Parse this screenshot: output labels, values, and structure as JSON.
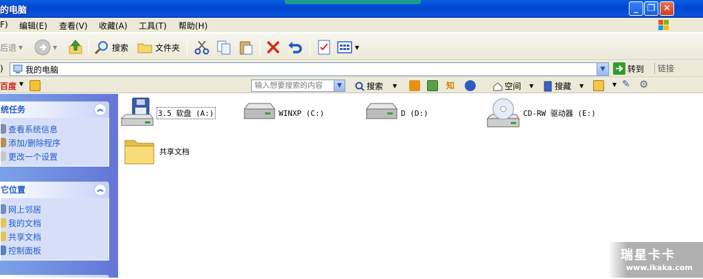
{
  "window": {
    "title": "的电脑",
    "minimize": "_",
    "restore": "❐",
    "close": "✕"
  },
  "menu": [
    "F)",
    "编辑(E)",
    "查看(V)",
    "收藏(A)",
    "工具(T)",
    "帮助(H)"
  ],
  "toolbar": {
    "back": "后退",
    "search": "搜索",
    "folders": "文件夹"
  },
  "address": {
    "value": "我的电脑",
    "go": "转到",
    "links": "链接"
  },
  "baidu": {
    "logo": "百度",
    "search_placeholder": "输入想要搜索的内容",
    "search_btn": "搜索",
    "space": "空间",
    "collect": "搜藏"
  },
  "left_panels": {
    "system_tasks": {
      "title": "统任务",
      "items": [
        "查看系统信息",
        "添加/删除程序",
        "更改一个设置"
      ]
    },
    "other_places": {
      "title": "它位置",
      "items": [
        "网上邻居",
        "我的文档",
        "共享文档",
        "控制面板"
      ]
    }
  },
  "drives": [
    {
      "label": "3.5 软盘 (A:)",
      "icon": "floppy-icon"
    },
    {
      "label": "WINXP (C:)",
      "icon": "hard-drive-icon"
    },
    {
      "label": "D (D:)",
      "icon": "hard-drive-icon"
    },
    {
      "label": "CD-RW 驱动器 (E:)",
      "icon": "cd-drive-icon"
    },
    {
      "label": "共享文档",
      "icon": "folder-icon"
    }
  ],
  "watermark": {
    "main": "瑞星卡卡",
    "sub": "www.ikaka.com"
  },
  "colors": {
    "title_blue": "#0047d1",
    "task_blue": "#215dc6",
    "pane_bg": "#d6dff7"
  }
}
